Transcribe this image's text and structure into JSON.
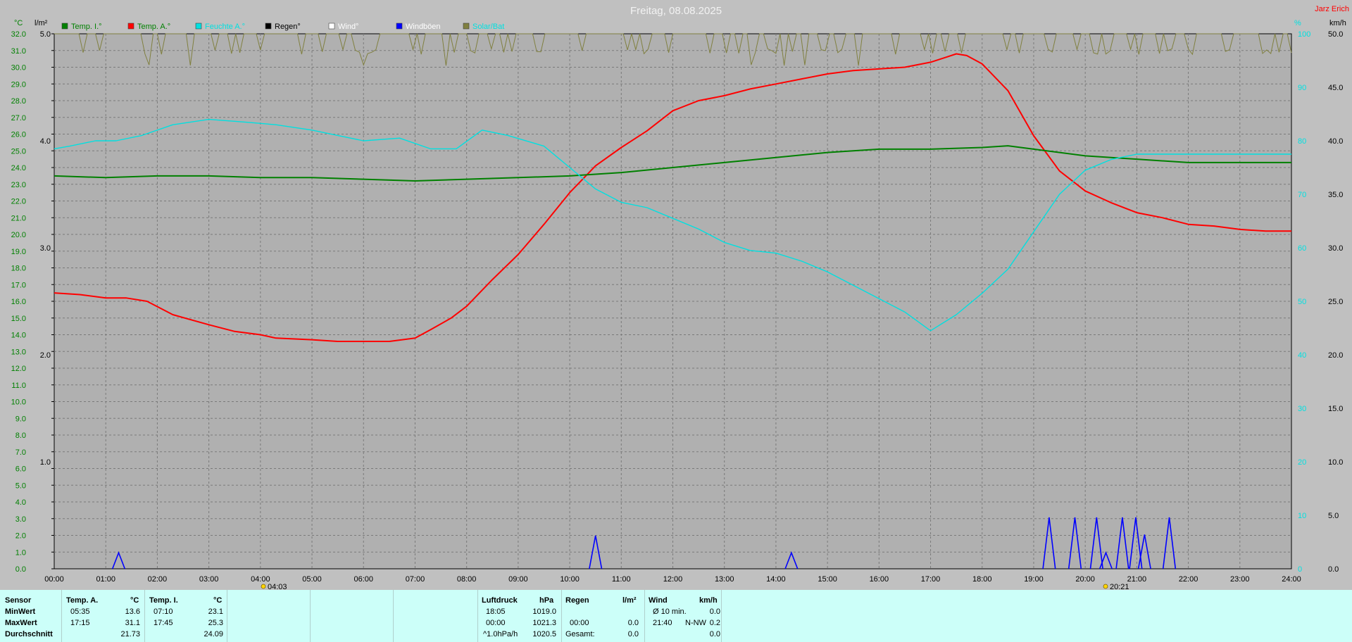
{
  "header": {
    "title": "Freitag, 08.08.2025",
    "station": "Jarz Erich",
    "unit_left_temp": "°C",
    "unit_left_rain": "l/m²",
    "unit_right_pct": "%",
    "unit_right_wind": "km/h"
  },
  "legend": [
    {
      "label": "Temp. I.°",
      "color": "#008000",
      "text_color": "#008000"
    },
    {
      "label": "Temp. A.°",
      "color": "#ff0000",
      "text_color": "#008000"
    },
    {
      "label": "Feuchte A.°",
      "color": "#00e0e0",
      "text_color": "#00e0e0"
    },
    {
      "label": "Regen°",
      "color": "#000000",
      "text_color": "#000000"
    },
    {
      "label": "Wind°",
      "color": "#ffffff",
      "text_color": "#ffffff"
    },
    {
      "label": "Windböen",
      "color": "#0000ff",
      "text_color": "#ffffff"
    },
    {
      "label": "Solar/Bat",
      "color": "#808040",
      "text_color": "#00e0e0"
    }
  ],
  "sun_marks": {
    "sunrise": "04:03",
    "sunset": "20:21"
  },
  "chart_data": {
    "type": "line",
    "x_unit": "hour",
    "xlim": [
      0,
      24
    ],
    "x_ticks": [
      "00:00",
      "01:00",
      "02:00",
      "03:00",
      "04:00",
      "05:00",
      "06:00",
      "07:00",
      "08:00",
      "09:00",
      "10:00",
      "11:00",
      "12:00",
      "13:00",
      "14:00",
      "15:00",
      "16:00",
      "17:00",
      "18:00",
      "19:00",
      "20:00",
      "21:00",
      "22:00",
      "23:00",
      "24:00"
    ],
    "y_left_temp": {
      "label": "°C",
      "lim": [
        0,
        32
      ],
      "ticks": [
        "0.0",
        "1.0",
        "2.0",
        "3.0",
        "4.0",
        "5.0",
        "6.0",
        "7.0",
        "8.0",
        "9.0",
        "10.0",
        "11.0",
        "12.0",
        "13.0",
        "14.0",
        "15.0",
        "16.0",
        "17.0",
        "18.0",
        "19.0",
        "20.0",
        "21.0",
        "22.0",
        "23.0",
        "24.0",
        "25.0",
        "26.0",
        "27.0",
        "28.0",
        "29.0",
        "30.0",
        "31.0",
        "32.0"
      ]
    },
    "y_left_rain": {
      "label": "l/m²",
      "lim": [
        0,
        5
      ],
      "ticks": [
        "1.0",
        "2.0",
        "3.0",
        "4.0",
        "5.0"
      ]
    },
    "y_right_wind": {
      "label": "km/h",
      "lim": [
        0,
        50
      ],
      "ticks": [
        "0.0",
        "5.0",
        "10.0",
        "15.0",
        "20.0",
        "25.0",
        "30.0",
        "35.0",
        "40.0",
        "45.0",
        "50.0"
      ]
    },
    "y_right_pct": {
      "label": "%",
      "lim": [
        0,
        100
      ],
      "ticks": [
        "0",
        "10",
        "20",
        "30",
        "40",
        "50",
        "60",
        "70",
        "80",
        "90",
        "100"
      ]
    },
    "grid": true,
    "series": [
      {
        "name": "Temp. A.°",
        "axis": "temp",
        "color": "#ff0000",
        "x": [
          0,
          0.5,
          1,
          1.4,
          1.8,
          2.3,
          3,
          3.5,
          4,
          4.3,
          5,
          5.5,
          6,
          6.5,
          7,
          7.3,
          7.7,
          8,
          8.5,
          9,
          9.5,
          10,
          10.5,
          11,
          11.5,
          12,
          12.5,
          13,
          13.5,
          14,
          14.5,
          15,
          15.5,
          16,
          16.5,
          17,
          17.3,
          17.5,
          17.7,
          18,
          18.5,
          19,
          19.5,
          20,
          20.5,
          21,
          21.5,
          22,
          22.5,
          23,
          23.5,
          24
        ],
        "values": [
          16.5,
          16.4,
          16.2,
          16.2,
          16.0,
          15.2,
          14.6,
          14.2,
          14.0,
          13.8,
          13.7,
          13.6,
          13.6,
          13.6,
          13.8,
          14.3,
          15.0,
          15.7,
          17.3,
          18.8,
          20.6,
          22.5,
          24.1,
          25.2,
          26.2,
          27.4,
          28.0,
          28.3,
          28.7,
          29.0,
          29.3,
          29.6,
          29.8,
          29.9,
          30.0,
          30.3,
          30.6,
          30.8,
          30.7,
          30.2,
          28.6,
          25.9,
          23.8,
          22.6,
          21.9,
          21.3,
          21.0,
          20.6,
          20.5,
          20.3,
          20.2,
          20.2
        ]
      },
      {
        "name": "Temp. I.°",
        "axis": "temp",
        "color": "#008000",
        "x": [
          0,
          1,
          2,
          3,
          4,
          5,
          6,
          7,
          8,
          9,
          10,
          11,
          12,
          13,
          14,
          15,
          16,
          17,
          18,
          18.5,
          19,
          20,
          21,
          22,
          23,
          24
        ],
        "values": [
          23.5,
          23.4,
          23.5,
          23.5,
          23.4,
          23.4,
          23.3,
          23.2,
          23.3,
          23.4,
          23.5,
          23.7,
          24.0,
          24.3,
          24.6,
          24.9,
          25.1,
          25.1,
          25.2,
          25.3,
          25.1,
          24.7,
          24.5,
          24.3,
          24.3,
          24.3
        ]
      },
      {
        "name": "Feuchte A.°",
        "axis": "pct",
        "color": "#00e0e0",
        "x": [
          0,
          0.3,
          0.8,
          1.2,
          1.7,
          2.3,
          3,
          3.7,
          4.3,
          5,
          5.5,
          6,
          6.7,
          7.3,
          7.8,
          8.3,
          8.8,
          9.5,
          10,
          10.5,
          11,
          11.5,
          12,
          12.5,
          13,
          13.5,
          14,
          14.5,
          15,
          15.5,
          16,
          16.5,
          17,
          17.5,
          18,
          18.5,
          19,
          19.5,
          20,
          20.5,
          21,
          21.5,
          22,
          23,
          24
        ],
        "values": [
          78.5,
          79,
          80,
          80,
          81,
          83,
          84,
          83.5,
          83,
          82,
          81,
          80,
          80.5,
          78.5,
          78.5,
          82,
          81,
          79,
          75,
          71,
          68.5,
          67.5,
          65.5,
          63.5,
          61,
          59.5,
          59,
          57.5,
          55.5,
          53,
          50.5,
          48,
          44.5,
          47.5,
          51.5,
          56,
          63,
          70,
          74.5,
          76.5,
          77.5,
          77.5,
          77.5,
          77.5,
          77.5
        ]
      },
      {
        "name": "Windböen",
        "axis": "wind",
        "color": "#0000ff",
        "peaks": [
          {
            "x": 1.25,
            "value": 1.5
          },
          {
            "x": 10.5,
            "value": 3.1
          },
          {
            "x": 14.3,
            "value": 1.5
          },
          {
            "x": 19.3,
            "value": 4.8
          },
          {
            "x": 19.8,
            "value": 4.8
          },
          {
            "x": 20.22,
            "value": 4.8
          },
          {
            "x": 20.4,
            "value": 1.5
          },
          {
            "x": 20.72,
            "value": 4.8
          },
          {
            "x": 20.98,
            "value": 4.8
          },
          {
            "x": 21.15,
            "value": 3.2
          },
          {
            "x": 21.63,
            "value": 4.8
          }
        ]
      },
      {
        "name": "Solar/Bat",
        "axis": "pct",
        "color": "#808040",
        "description_values": "near 100 all day"
      }
    ]
  },
  "stats": {
    "sensor": {
      "title": "Sensor",
      "rows": [
        "MinWert",
        "MaxWert",
        "Durchschnitt"
      ]
    },
    "temp_a": {
      "title": "Temp. A.",
      "unit": "°C",
      "min_time": "05:35",
      "min": "13.6",
      "max_time": "17:15",
      "max": "31.1",
      "avg": "21.73"
    },
    "temp_i": {
      "title": "Temp. I.",
      "unit": "°C",
      "min_time": "07:10",
      "min": "23.1",
      "max_time": "17:45",
      "max": "25.3",
      "avg": "24.09"
    },
    "luftdruck": {
      "title": "Luftdruck",
      "unit": "hPa",
      "min_time": "18:05",
      "min": "1019.0",
      "max_time": "00:00",
      "max": "1021.3",
      "trend_label": "^1.0hPa/h",
      "trend": "1020.5"
    },
    "regen": {
      "title": "Regen",
      "unit": "l/m²",
      "max_time": "00:00",
      "max": "0.0",
      "total_label": "Gesamt:",
      "total": "0.0"
    },
    "wind": {
      "title": "Wind",
      "unit": "km/h",
      "avg_label": "Ø 10 min.",
      "avg": "0.0",
      "max_time": "21:40",
      "max_dir": "N-NW",
      "max": "0.2",
      "third": "0.0"
    }
  }
}
